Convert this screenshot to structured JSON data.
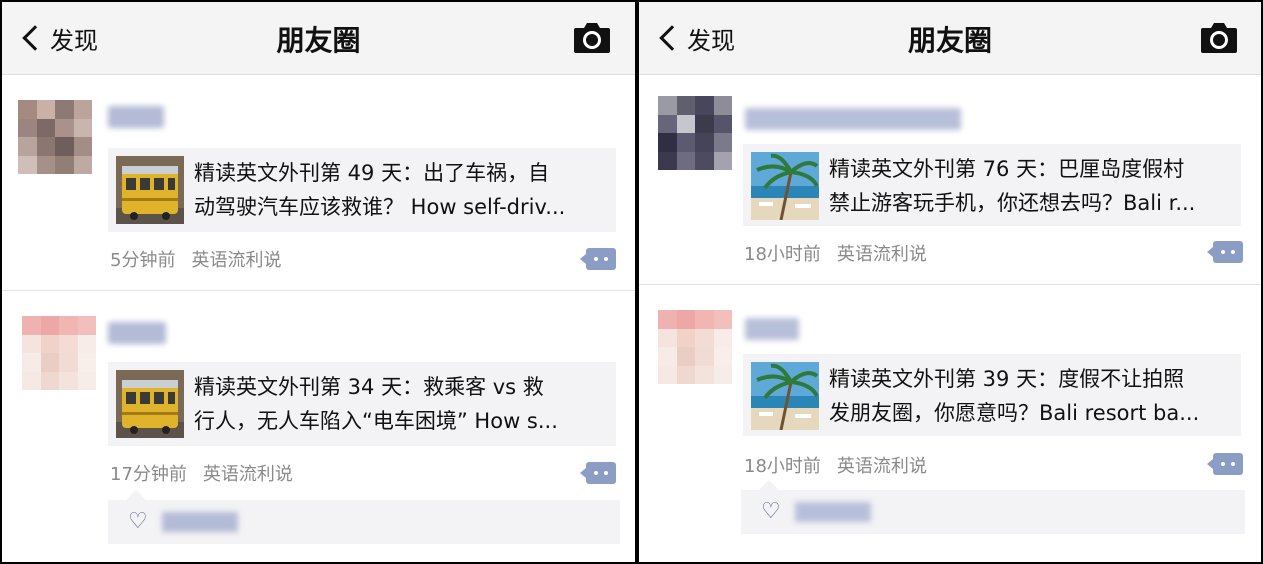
{
  "left": {
    "nav": {
      "back_label": "发现",
      "title": "朋友圈"
    },
    "posts": [
      {
        "link": {
          "line1": "精读英文外刊第 49 天：出了车祸，自",
          "line2": "动驾驶汽车应该救谁？ How self-driv..."
        },
        "time": "5分钟前",
        "source": "英语流利说"
      },
      {
        "link": {
          "line1": "精读英文外刊第 34 天：救乘客 vs 救",
          "line2": "行人，无人车陷入“电车困境” How s..."
        },
        "time": "17分钟前",
        "source": "英语流利说"
      }
    ]
  },
  "right": {
    "nav": {
      "back_label": "发现",
      "title": "朋友圈"
    },
    "posts": [
      {
        "link": {
          "line1": "精读英文外刊第 76 天：巴厘岛度假村",
          "line2": "禁止游客玩手机，你还想去吗？Bali r..."
        },
        "time": "18小时前",
        "source": "英语流利说"
      },
      {
        "link": {
          "line1": "精读英文外刊第 39 天：度假不让拍照",
          "line2": "发朋友圈，你愿意吗？Bali resort ba..."
        },
        "time": "18小时前",
        "source": "英语流利说"
      }
    ]
  },
  "icons": {
    "back": "chevron-left-icon",
    "camera": "camera-icon",
    "comment": "comment-dots-icon",
    "like": "heart-outline-icon",
    "like_glyph": "♡"
  },
  "colors": {
    "nav_bg": "#f4f4f4",
    "card_bg": "#f3f3f5",
    "meta_text": "#8a8a8a",
    "comment_btn": "#8c9dc5",
    "heart": "#5b6b92"
  }
}
